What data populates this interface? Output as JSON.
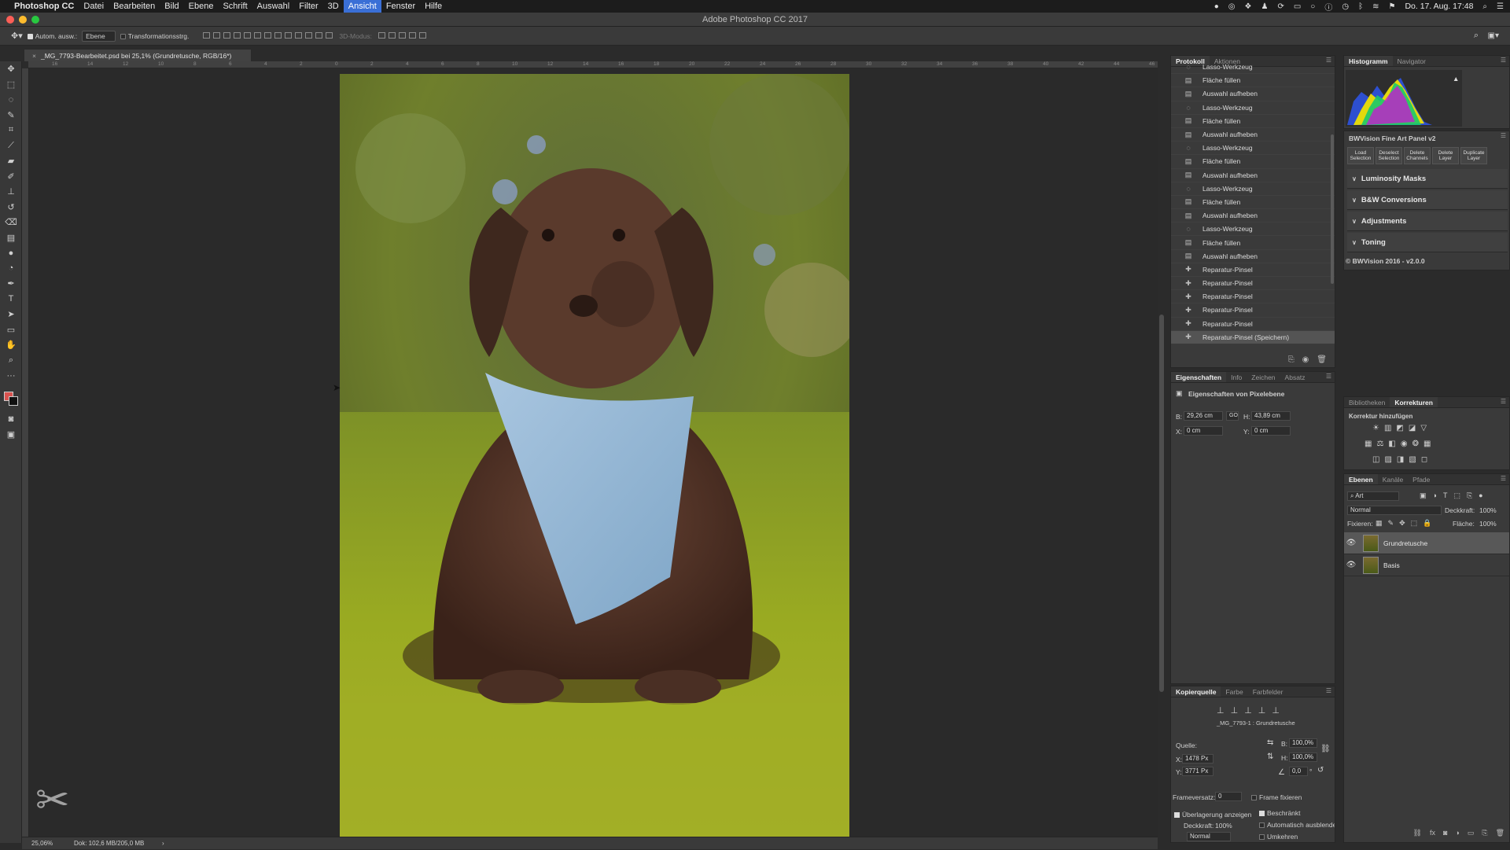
{
  "menubar": {
    "apple": "",
    "app_name": "Photoshop CC",
    "items": [
      "Datei",
      "Bearbeiten",
      "Bild",
      "Ebene",
      "Schrift",
      "Auswahl",
      "Filter",
      "3D",
      "Ansicht",
      "Fenster",
      "Hilfe"
    ],
    "active_item": "Ansicht",
    "clock": "Do. 17. Aug.  17:48"
  },
  "window": {
    "title": "Adobe Photoshop CC 2017"
  },
  "options_bar": {
    "auto_select_label": "Autom. ausw.:",
    "auto_select_target": "Ebene",
    "transform_label": "Transformationsstrg.",
    "mode_3d_label": "3D-Modus:"
  },
  "document": {
    "tab_title": "_MG_7793-Bearbeitet.psd bei 25,1% (Grundretusche, RGB/16*)",
    "zoom": "25,06%",
    "doc_size": "Dok: 102,6 MB/205,0 MB"
  },
  "ruler": {
    "h_ticks": [
      "16",
      "14",
      "12",
      "10",
      "8",
      "6",
      "4",
      "2",
      "0",
      "2",
      "4",
      "6",
      "8",
      "10",
      "12",
      "14",
      "16",
      "18",
      "20",
      "22",
      "24",
      "26",
      "28",
      "30",
      "32",
      "34",
      "36",
      "38",
      "40",
      "42",
      "44",
      "46"
    ]
  },
  "history_panel": {
    "tabs": [
      "Protokoll",
      "Aktionen"
    ],
    "items": [
      {
        "label": "Lasso-Werkzeug",
        "icon": "lasso-icon"
      },
      {
        "label": "Fläche füllen",
        "icon": "doc-icon"
      },
      {
        "label": "Auswahl aufheben",
        "icon": "doc-icon"
      },
      {
        "label": "Lasso-Werkzeug",
        "icon": "lasso-icon"
      },
      {
        "label": "Fläche füllen",
        "icon": "doc-icon"
      },
      {
        "label": "Auswahl aufheben",
        "icon": "doc-icon"
      },
      {
        "label": "Lasso-Werkzeug",
        "icon": "lasso-icon"
      },
      {
        "label": "Fläche füllen",
        "icon": "doc-icon"
      },
      {
        "label": "Auswahl aufheben",
        "icon": "doc-icon"
      },
      {
        "label": "Lasso-Werkzeug",
        "icon": "lasso-icon"
      },
      {
        "label": "Fläche füllen",
        "icon": "doc-icon"
      },
      {
        "label": "Auswahl aufheben",
        "icon": "doc-icon"
      },
      {
        "label": "Lasso-Werkzeug",
        "icon": "lasso-icon"
      },
      {
        "label": "Fläche füllen",
        "icon": "doc-icon"
      },
      {
        "label": "Auswahl aufheben",
        "icon": "doc-icon"
      },
      {
        "label": "Reparatur-Pinsel",
        "icon": "bandage-icon"
      },
      {
        "label": "Reparatur-Pinsel",
        "icon": "bandage-icon"
      },
      {
        "label": "Reparatur-Pinsel",
        "icon": "bandage-icon"
      },
      {
        "label": "Reparatur-Pinsel",
        "icon": "bandage-icon"
      },
      {
        "label": "Reparatur-Pinsel",
        "icon": "bandage-icon"
      },
      {
        "label": "Reparatur-Pinsel (Speichern)",
        "icon": "bandage-icon",
        "selected": true
      }
    ]
  },
  "properties_panel": {
    "tabs": [
      "Eigenschaften",
      "Info",
      "Zeichen",
      "Absatz"
    ],
    "heading": "Eigenschaften von Pixelebene",
    "w_label": "B:",
    "w_value": "29,26 cm",
    "h_label": "H:",
    "h_value": "43,89 cm",
    "link_label": "GO",
    "x_label": "X:",
    "x_value": "0 cm",
    "y_label": "Y:",
    "y_value": "0 cm"
  },
  "clone_panel": {
    "tabs": [
      "Kopierquelle",
      "Farbe",
      "Farbfelder"
    ],
    "source_name": "_MG_7793-1 : Grundretusche",
    "source_label": "Quelle:",
    "x_label": "X:",
    "x_value": "1478 Px",
    "y_label": "Y:",
    "y_value": "3771 Px",
    "w_label": "B:",
    "w_value": "100,0%",
    "h_label": "H:",
    "h_value": "100,0%",
    "angle_value": "0,0",
    "angle_unit": "°",
    "frame_offset_label": "Frameversatz:",
    "frame_offset_value": "0",
    "frame_lock_label": "Frame fixieren",
    "show_overlay_label": "Überlagerung anzeigen",
    "clipped_label": "Beschränkt",
    "opacity_label": "Deckkraft:",
    "opacity_value": "100%",
    "auto_hide_label": "Automatisch ausblenden",
    "blend_mode": "Normal",
    "invert_label": "Umkehren"
  },
  "histogram_panel": {
    "tabs": [
      "Histogramm",
      "Navigator"
    ],
    "warning_icon": "▲"
  },
  "bwvision": {
    "title": "BWVision Fine Art Panel v2",
    "buttons": [
      {
        "l1": "Load",
        "l2": "Selection"
      },
      {
        "l1": "Deselect",
        "l2": "Selection"
      },
      {
        "l1": "Delete",
        "l2": "Channels"
      },
      {
        "l1": "Delete",
        "l2": "Layer"
      },
      {
        "l1": "Duplicate",
        "l2": "Layer"
      }
    ],
    "sections": [
      "Luminosity Masks",
      "B&W Conversions",
      "Adjustments",
      "Toning"
    ],
    "footer": "© BWVision 2016 - v2.0.0"
  },
  "adjustments_panel": {
    "tabs": [
      "Bibliotheken",
      "Korrekturen"
    ],
    "heading": "Korrektur hinzufügen"
  },
  "layers_panel": {
    "tabs": [
      "Ebenen",
      "Kanäle",
      "Pfade"
    ],
    "filter_kind": "Art",
    "blend_mode": "Normal",
    "opacity_label": "Deckkraft:",
    "opacity_value": "100%",
    "lock_label": "Fixieren:",
    "fill_label": "Fläche:",
    "fill_value": "100%",
    "layers": [
      {
        "name": "Grundretusche",
        "selected": true
      },
      {
        "name": "Basis",
        "selected": false
      }
    ]
  },
  "colors": {
    "menubar_bg": "#1c1c1c",
    "accent": "#3a6fd6",
    "panel_bg": "#3a3a3a",
    "bandana": "#8fb5d4"
  }
}
